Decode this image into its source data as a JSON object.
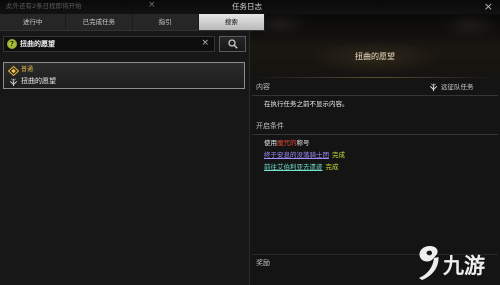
{
  "window": {
    "notice": "此外还有2条日程即将开始",
    "notice_close_glyph": "×",
    "title": "任务日志",
    "close_glyph": "×",
    "close_icon": "close-icon"
  },
  "tabs": [
    {
      "label": "进行中",
      "selected": false
    },
    {
      "label": "已完成任务",
      "selected": false
    },
    {
      "label": "指引",
      "selected": false
    },
    {
      "label": "搜索",
      "selected": true
    }
  ],
  "search": {
    "value": "扭曲的愿望",
    "type_icon": "question-icon",
    "type_icon_glyph": "?",
    "clear_glyph": "×",
    "button_icon": "search-icon"
  },
  "results": [
    {
      "grade": "普通",
      "name": "扭曲的愿望",
      "icon": "quest-diamond-icon",
      "type_icon": "expedition-icon",
      "selected": true
    }
  ],
  "detail": {
    "title": "扭曲的愿望",
    "content_label": "内容",
    "quest_type_icon": "expedition-icon",
    "quest_type": "远征队任务",
    "content_text": "在执行任务之前不显示内容。",
    "conditions_label": "开启条件",
    "conditions": [
      {
        "parts": [
          {
            "text": "使用",
            "color": "#ececec"
          },
          {
            "text": "魔咒的",
            "color": "#e2483a"
          },
          {
            "text": "称号",
            "color": "#ececec"
          }
        ]
      },
      {
        "parts": [
          {
            "text": "终于安息的没落骑士团",
            "color": "#a38cff",
            "link": true
          },
          {
            "text": "完成",
            "color": "#c8de38"
          }
        ]
      },
      {
        "parts": [
          {
            "text": "前往艾伯利亚去遗迹",
            "color": "#74e2cf",
            "link": true
          },
          {
            "text": "完成",
            "color": "#c8de38"
          }
        ]
      }
    ],
    "rewards_label": "奖励"
  },
  "watermark": {
    "text": "九游",
    "icon": "jiuyou-logo-icon"
  },
  "colors": {
    "background": "#151515",
    "selected_tab": "#d0d0d0",
    "title_gold": "#efe3c4",
    "grade_gold": "#e0b84a",
    "search_type_green": "#a3b82c"
  }
}
